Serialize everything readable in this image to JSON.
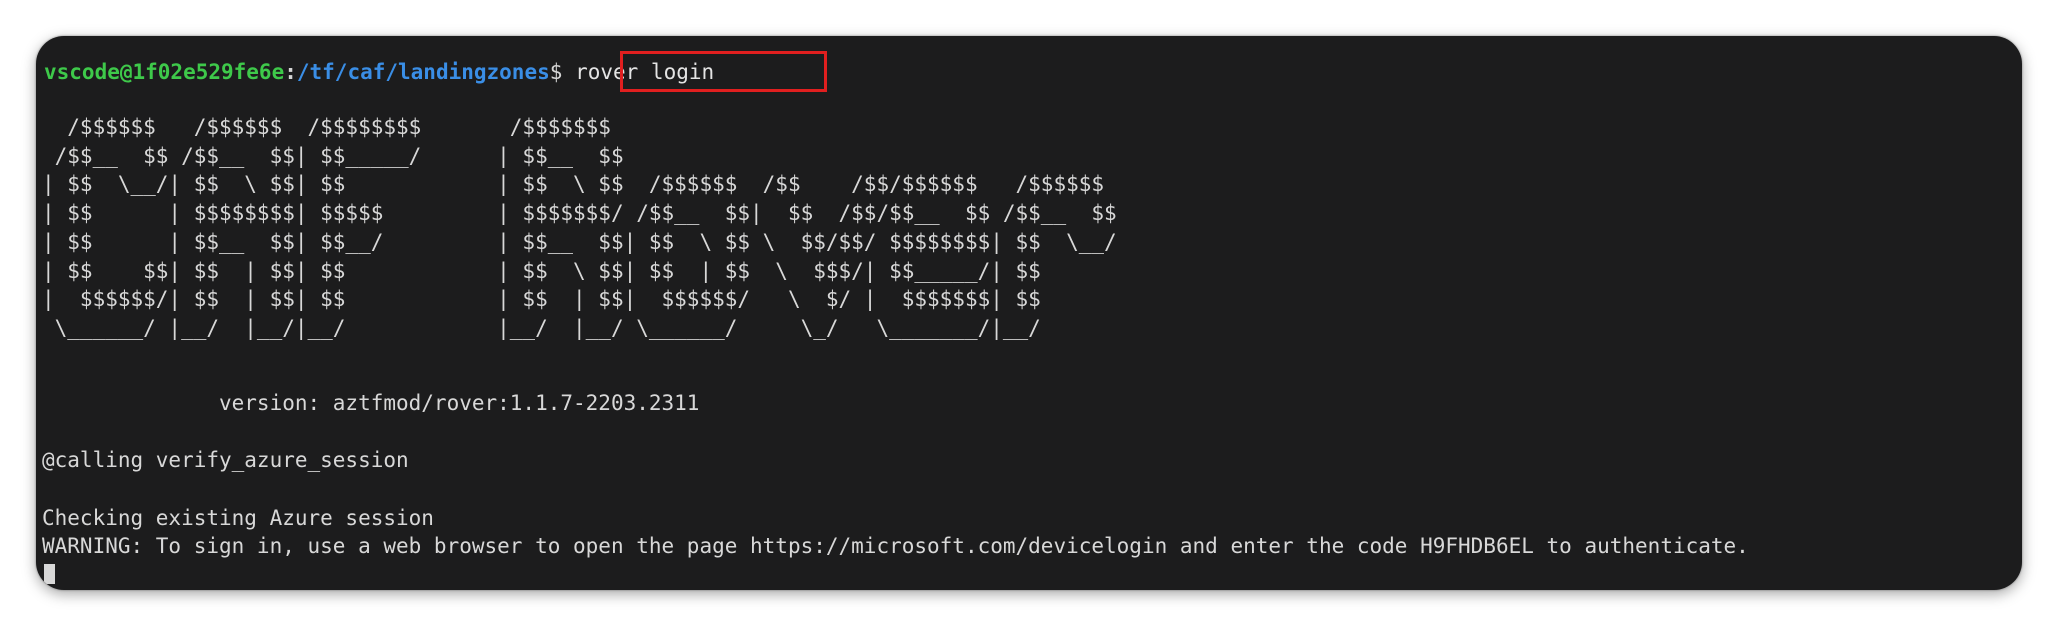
{
  "window": {
    "prompt": {
      "user_host": "vscode@1f02e529fe6e",
      "separator": ":",
      "path": "/tf/caf/landingzones",
      "symbol": "$",
      "command": "rover login"
    },
    "banner_ascii": "  /$$$$$$   /$$$$$$  /$$$$$$$$       /$$$$$$$\n /$$__  $$ /$$__  $$| $$_____/      | $$__  $$\n| $$  \\__/| $$  \\ $$| $$            | $$  \\ $$  /$$$$$$  /$$    /$$/$$$$$$   /$$$$$$\n| $$      | $$$$$$$$| $$$$$         | $$$$$$$/ /$$__  $$|  $$  /$$/$$__  $$ /$$__  $$\n| $$      | $$__  $$| $$__/         | $$__  $$| $$  \\ $$ \\  $$/$$/ $$$$$$$$| $$  \\__/\n| $$    $$| $$  | $$| $$            | $$  \\ $$| $$  | $$  \\  $$$/| $$_____/| $$\n|  $$$$$$/| $$  | $$| $$            | $$  | $$|  $$$$$$/   \\  $/ |  $$$$$$$| $$\n \\______/ |__/  |__/|__/            |__/  |__/ \\______/     \\_/   \\_______/|__/",
    "output": {
      "version_line": "              version: aztfmod/rover:1.1.7-2203.2311",
      "calling_line": "@calling verify_azure_session",
      "checking_line": "Checking existing Azure session",
      "warning_line": "WARNING: To sign in, use a web browser to open the page https://microsoft.com/devicelogin and enter the code H9FHDB6EL to authenticate."
    }
  }
}
